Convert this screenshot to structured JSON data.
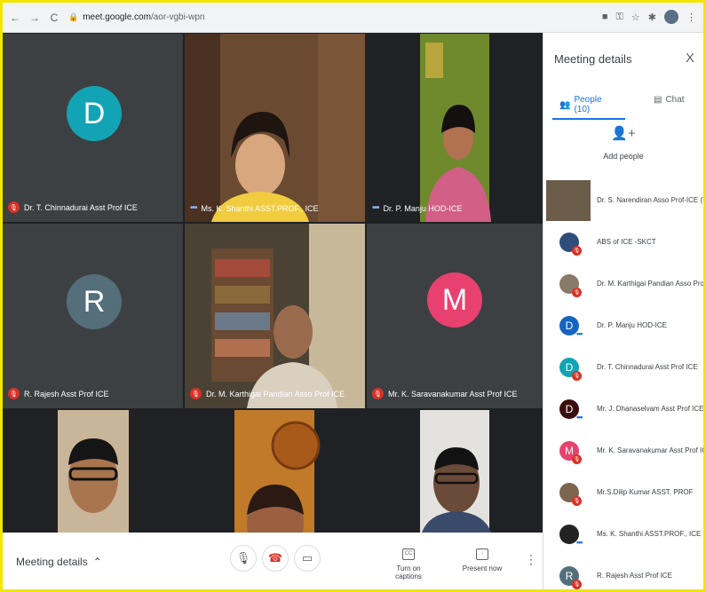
{
  "browser": {
    "back_icon": "←",
    "forward_icon": "→",
    "reload_icon": "C",
    "url_host": "meet.google.com",
    "url_path": "/aor-vgbi-wpn"
  },
  "tiles": [
    {
      "name": "Dr. T. Chinnadurai Asst Prof ICE",
      "type": "avatar",
      "letter": "D",
      "color": "#12a4b4",
      "status": "muted"
    },
    {
      "name": "Ms. K. Shanthi ASST.PROF., ICE",
      "type": "camera",
      "status": "speaking"
    },
    {
      "name": "Dr. P. Manju HOD-ICE",
      "type": "camera",
      "status": "speaking"
    },
    {
      "name": "R. Rajesh Asst Prof ICE",
      "type": "avatar",
      "letter": "R",
      "color": "#546e7a",
      "status": "muted"
    },
    {
      "name": "Dr. M. Karthigai Pandian Asso Prof ICE",
      "type": "camera",
      "status": "muted"
    },
    {
      "name": "Mr. K. Saravanakumar Asst Prof ICE",
      "type": "avatar",
      "letter": "M",
      "color": "#e8416f",
      "status": "muted"
    },
    {
      "name": "",
      "type": "camera"
    },
    {
      "name": "",
      "type": "camera"
    },
    {
      "name": "",
      "type": "camera"
    }
  ],
  "bottombar": {
    "meeting_details": "Meeting details",
    "captions_label": "Turn on captions",
    "captions_icon": "CC",
    "present_label": "Present now"
  },
  "panel": {
    "title": "Meeting details",
    "close": "X",
    "tab_people": "People (10)",
    "tab_chat": "Chat",
    "add_people": "Add people",
    "people": [
      {
        "name": "Dr. S. Narendiran Asso Prof-ICE (You)",
        "type": "photo",
        "color": "#6b5d4a"
      },
      {
        "name": "ABS of ICE -SKCT",
        "type": "photo",
        "color": "#2e4d7a",
        "status": "muted"
      },
      {
        "name": "Dr. M. Karthigai Pandian Asso Prof ICE",
        "type": "photo",
        "color": "#8a7a68",
        "status": "muted"
      },
      {
        "name": "Dr. P. Manju HOD-ICE",
        "type": "letter",
        "letter": "D",
        "color": "#1565c0",
        "status": "speaking"
      },
      {
        "name": "Dr. T. Chinnadurai Asst Prof ICE",
        "type": "letter",
        "letter": "D",
        "color": "#12a4b4",
        "status": "muted"
      },
      {
        "name": "Mr. J. Dhanaselvam Asst Prof ICE",
        "type": "letter",
        "letter": "D",
        "color": "#3a0d0d",
        "status": "speaking"
      },
      {
        "name": "Mr. K. Saravanakumar Asst Prof ICE",
        "type": "letter",
        "letter": "M",
        "color": "#e8416f",
        "status": "muted"
      },
      {
        "name": "Mr.S.Dilip Kumar ASST. PROF",
        "type": "photo",
        "color": "#7c6650",
        "status": "muted"
      },
      {
        "name": "Ms. K. Shanthi ASST.PROF., ICE",
        "type": "photo",
        "color": "#222222",
        "status": "speaking"
      },
      {
        "name": "R. Rajesh Asst Prof ICE",
        "type": "letter",
        "letter": "R",
        "color": "#546e7a",
        "status": "muted"
      }
    ]
  }
}
